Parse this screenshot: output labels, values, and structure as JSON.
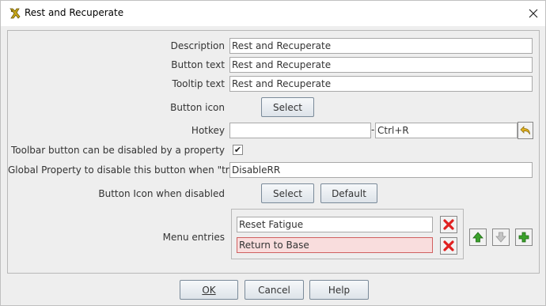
{
  "window": {
    "title": "Rest and Recuperate"
  },
  "form": {
    "description_label": "Description",
    "description_value": "Rest and Recuperate",
    "button_text_label": "Button text",
    "button_text_value": "Rest and Recuperate",
    "tooltip_label": "Tooltip text",
    "tooltip_value": "Rest and Recuperate",
    "button_icon_label": "Button icon",
    "button_icon_select": "Select",
    "hotkey_label": "Hotkey",
    "hotkey_value": "",
    "hotkey_separator": "-",
    "hotkey_display": "Ctrl+R",
    "toolbar_disable_label": "Toolbar button can be disabled by a property",
    "toolbar_disable_checked": true,
    "global_property_label": "Global Property to disable this button when \"true\"",
    "global_property_value": "DisableRR",
    "icon_disabled_label": "Button Icon when disabled",
    "icon_disabled_select": "Select",
    "icon_disabled_default": "Default",
    "menu_entries_label": "Menu entries",
    "menu_entries": [
      {
        "value": "Reset Fatigue",
        "error": false
      },
      {
        "value": "Return to Base",
        "error": true
      }
    ]
  },
  "footer": {
    "ok_label": "OK",
    "cancel_label": "Cancel",
    "help_label": "Help"
  },
  "colors": {
    "error_bg": "#f9dddd",
    "error_border": "#d06060",
    "delete_red": "#e02020",
    "arrow_green": "#3aa12a",
    "arrow_disabled": "#b8b8b8"
  },
  "icons": {
    "app": "vassal-app-icon",
    "close": "close-icon",
    "hotkey_undo": "undo-arrow-icon",
    "delete": "red-x-icon",
    "move_up": "green-up-arrow-icon",
    "move_down": "gray-down-arrow-icon",
    "add": "green-plus-icon"
  }
}
